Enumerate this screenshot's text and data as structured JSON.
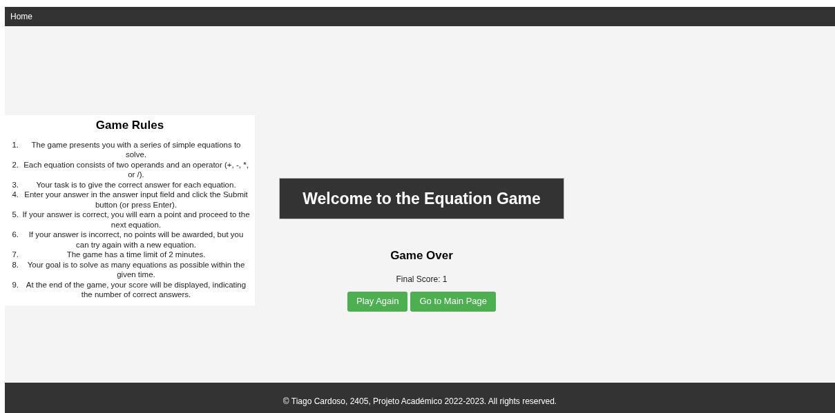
{
  "nav": {
    "links": [
      "Home"
    ]
  },
  "rules": {
    "title": "Game Rules",
    "items": [
      {
        "number": "1.",
        "text": "The game presents you with a series of simple equations to solve."
      },
      {
        "number": "2.",
        "text": "Each equation consists of two operands and an operator (+, -, *, or /)."
      },
      {
        "number": "3.",
        "text": "Your task is to give the correct answer for each equation."
      },
      {
        "number": "4.",
        "text": "Enter your answer in the answer input field and click the Submit button (or press Enter)."
      },
      {
        "number": "5.",
        "text": "If your answer is correct, you will earn a point and proceed to the next equation."
      },
      {
        "number": "6.",
        "text": "If your answer is incorrect, no points will be awarded, but you can try again with a new equation."
      },
      {
        "number": "7.",
        "text": "The game has a time limit of 2 minutes."
      },
      {
        "number": "8.",
        "text": "Your goal is to solve as many equations as possible within the given time."
      },
      {
        "number": "9.",
        "text": "At the end of the game, your score will be displayed, indicating the number of correct answers."
      }
    ]
  },
  "game": {
    "title": "Welcome to the Equation Game",
    "status": "Game Over",
    "score": "Final Score: 1",
    "buttons": [
      "Play Again",
      "Go to Main Page"
    ]
  },
  "footer": "© Tiago Cardoso, 2405, Projeto Académico 2022-2023. All rights reserved."
}
